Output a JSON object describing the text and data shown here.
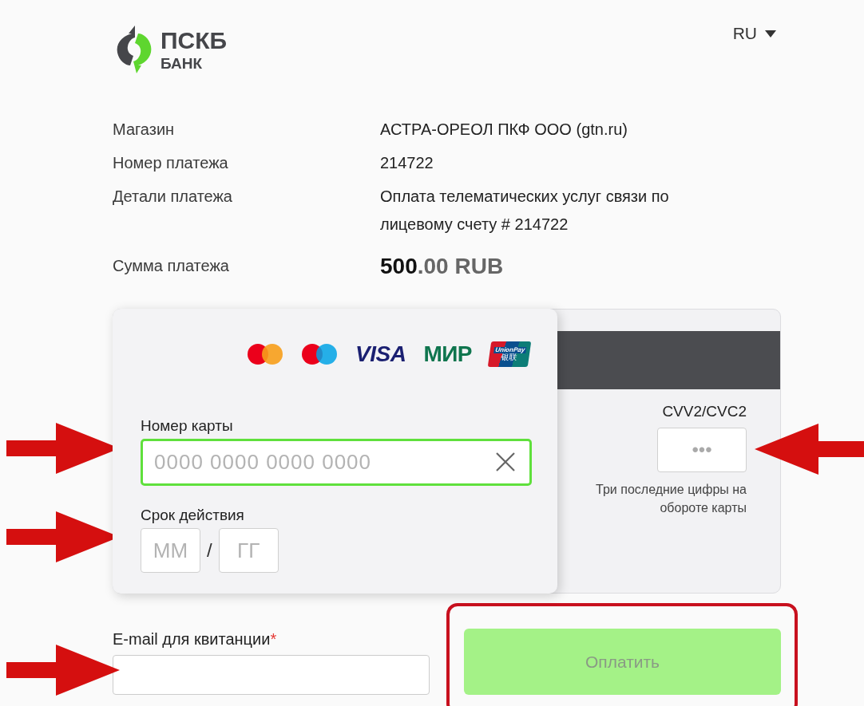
{
  "header": {
    "logo": {
      "name": "ПСКБ",
      "subtitle": "БАНК"
    },
    "language": "RU"
  },
  "details": [
    {
      "label": "Магазин",
      "value": "АСТРА-ОРЕОЛ ПКФ ООО (gtn.ru)"
    },
    {
      "label": "Номер платежа",
      "value": "214722"
    },
    {
      "label": "Детали платежа",
      "value": "Оплата телематических услуг связи по лицевому счету # 214722"
    }
  ],
  "amount": {
    "label": "Сумма платежа",
    "integer": "500",
    "fraction": ".00",
    "currency": "RUB"
  },
  "card": {
    "brands": [
      {
        "kind": "mastercard"
      },
      {
        "kind": "maestro"
      },
      {
        "kind": "visa",
        "text": "VISA"
      },
      {
        "kind": "mir",
        "text": "МИР"
      },
      {
        "kind": "unionpay",
        "text": "UnionPay",
        "subtext": "银联"
      }
    ],
    "number": {
      "label": "Номер карты",
      "placeholder": "0000 0000 0000 0000",
      "focused": true
    },
    "expiry": {
      "label": "Срок действия",
      "month_placeholder": "ММ",
      "separator": "/",
      "year_placeholder": "ГГ"
    },
    "cvv": {
      "label": "CVV2/CVC2",
      "placeholder": "•••",
      "hint": "Три последние цифры на обороте карты"
    }
  },
  "email": {
    "label": "E-mail для квитанции",
    "required_mark": "*"
  },
  "pay_button": {
    "label": "Оплатить",
    "disabled": true
  }
}
